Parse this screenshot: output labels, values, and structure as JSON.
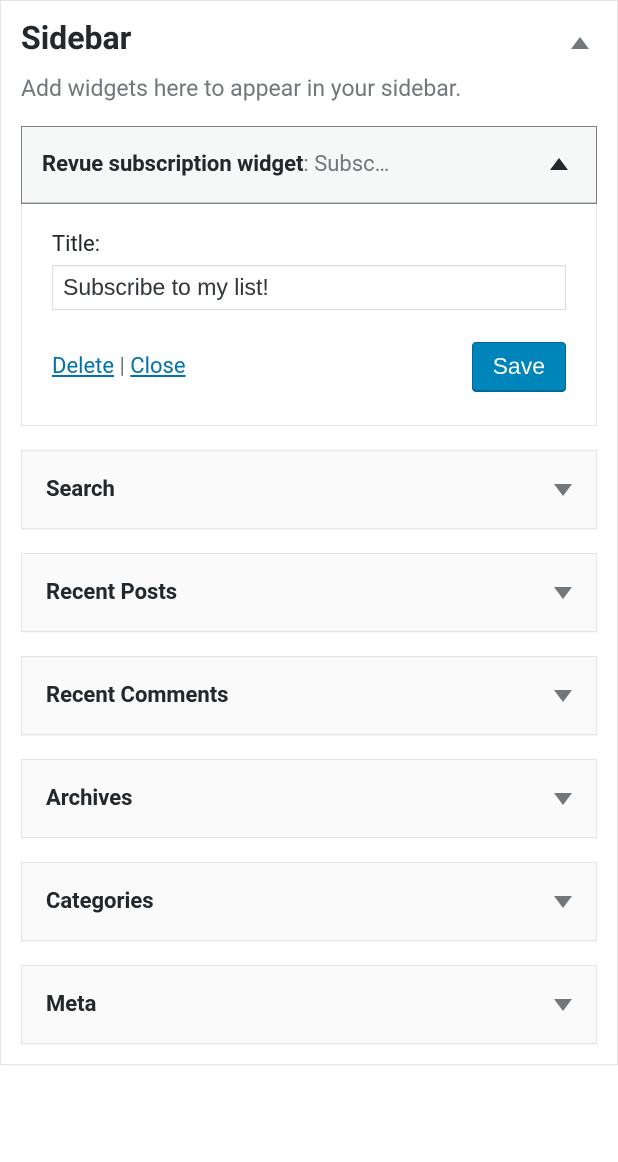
{
  "panel": {
    "title": "Sidebar",
    "description": "Add widgets here to appear in your sidebar."
  },
  "expanded_widget": {
    "name": "Revue subscription widget",
    "inline_desc": ": Subsc…",
    "form": {
      "title_label": "Title:",
      "title_value": "Subscribe to my list!"
    },
    "controls": {
      "delete_label": "Delete",
      "separator": " | ",
      "close_label": "Close",
      "save_label": "Save"
    }
  },
  "collapsed_widgets": [
    {
      "title": "Search"
    },
    {
      "title": "Recent Posts"
    },
    {
      "title": "Recent Comments"
    },
    {
      "title": "Archives"
    },
    {
      "title": "Categories"
    },
    {
      "title": "Meta"
    }
  ]
}
